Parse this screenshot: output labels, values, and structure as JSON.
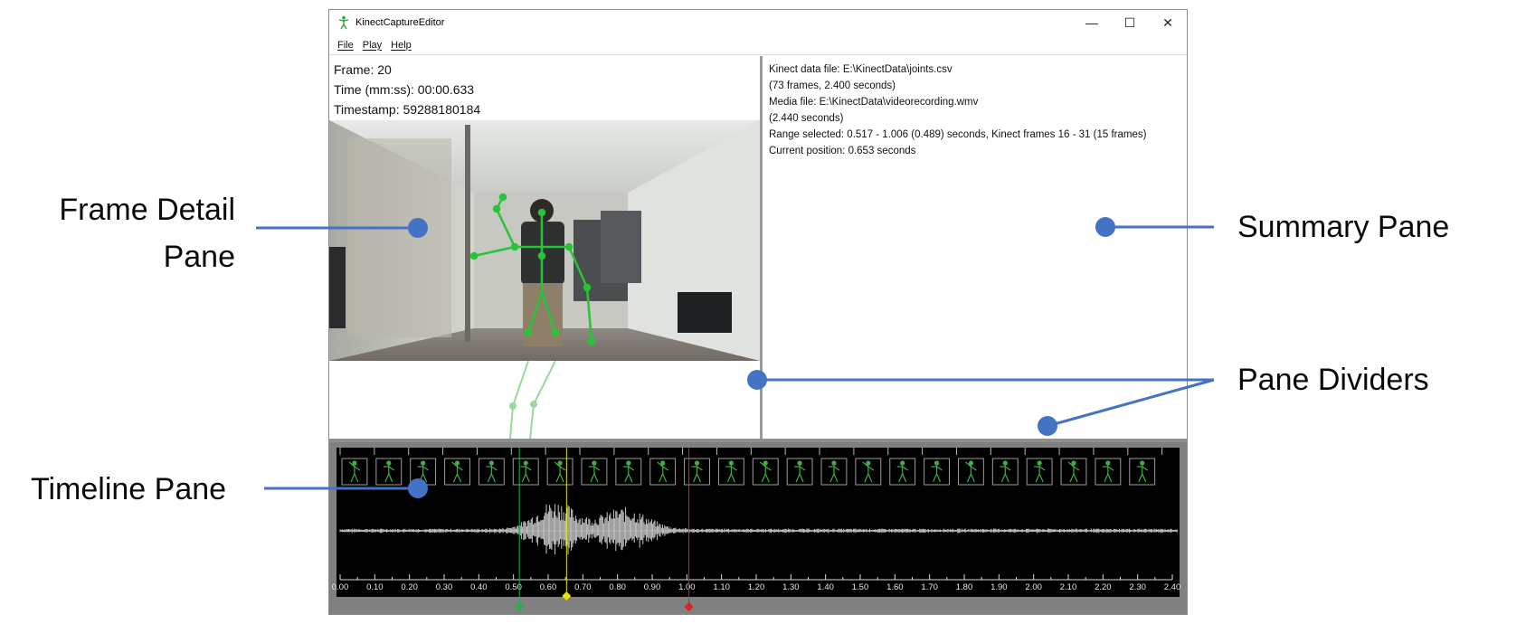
{
  "window": {
    "title": "KinectCaptureEditor",
    "controls": {
      "minimize": "—",
      "maximize": "☐",
      "close": "✕"
    }
  },
  "menu": [
    {
      "label": "File"
    },
    {
      "label": "Play"
    },
    {
      "label": "Help"
    }
  ],
  "frame_detail": {
    "frame": "Frame: 20",
    "time": "Time (mm:ss): 00:00.633",
    "timestamp": "Timestamp: 59288180184"
  },
  "summary": {
    "lines": [
      "Kinect data file: E:\\KinectData\\joints.csv",
      "(73 frames, 2.400 seconds)",
      "Media file: E:\\KinectData\\videorecording.wmv",
      "(2.440 seconds)",
      "Range selected: 0.517 - 1.006 (0.489) seconds, Kinect frames 16 - 31 (15 frames)",
      "Current position: 0.653 seconds"
    ]
  },
  "timeline": {
    "tick_labels": [
      "0.00",
      "0.10",
      "0.20",
      "0.30",
      "0.40",
      "0.50",
      "0.60",
      "0.70",
      "0.80",
      "0.90",
      "1.00",
      "1.10",
      "1.20",
      "1.30",
      "1.40",
      "1.50",
      "1.60",
      "1.70",
      "1.80",
      "1.90",
      "2.00",
      "2.10",
      "2.20",
      "2.30",
      "2.40"
    ],
    "markers": {
      "range_start_seconds": 0.517,
      "current_position_seconds": 0.653,
      "range_end_seconds": 1.006
    },
    "marker_colors": {
      "range_start": "#22b14c",
      "current": "#e6e600",
      "range_end": "#e02020"
    },
    "thumbnail_count": 24
  },
  "callouts": {
    "frame_detail": "Frame Detail Pane",
    "summary": "Summary Pane",
    "dividers": "Pane Dividers",
    "timeline": "Timeline Pane"
  },
  "accent_color": "#4472c4"
}
